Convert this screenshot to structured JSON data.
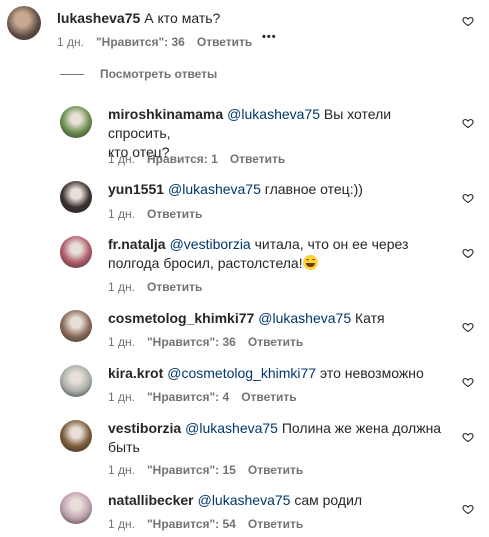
{
  "top_comment": {
    "username": "lukasheva75",
    "text": "А кто мать?",
    "time": "1 дн.",
    "likes": "\"Нравится\": 36",
    "reply": "Ответить",
    "more": "•••"
  },
  "view_replies_label": "Посмотреть ответы",
  "replies": [
    {
      "username": "miroshkinamama",
      "mention": "@lukasheva75",
      "text_line1": "Вы хотели спросить,",
      "text_line2": "кто отец?",
      "time": "1 дн.",
      "likes": "Нравится: 1",
      "reply": "Ответить",
      "avatar_color": "#6b8f4e"
    },
    {
      "username": "yun1551",
      "mention": "@lukasheva75",
      "text_line1": "главное отец:))",
      "time": "1 дн.",
      "likes": "",
      "reply": "Ответить",
      "avatar_color": "#3a3030"
    },
    {
      "username": "fr.natalja",
      "mention": "@vestiborzia",
      "text_line1": "читала, что он ее через",
      "text_line2": "полгода бросил, растолстела!",
      "emoji": "😂",
      "time": "1 дн.",
      "likes": "",
      "reply": "Ответить",
      "avatar_color": "#b05a6a"
    },
    {
      "username": "cosmetolog_khimki77",
      "mention": "@lukasheva75",
      "text_line1": "Катя",
      "time": "1 дн.",
      "likes": "\"Нравится\": 36",
      "reply": "Ответить",
      "avatar_color": "#8a6a5a"
    },
    {
      "username": "kira.krot",
      "mention": "@cosmetolog_khimki77",
      "text_line1": "это невозможно",
      "time": "1 дн.",
      "likes": "\"Нравится\": 4",
      "reply": "Ответить",
      "avatar_color": "#a8b0a8"
    },
    {
      "username": "vestiborzia",
      "mention": "@lukasheva75",
      "text_line1": "Полина же жена должна",
      "text_line2": "быть",
      "time": "1 дн.",
      "likes": "\"Нравится\": 15",
      "reply": "Ответить",
      "avatar_color": "#7a5a3a"
    },
    {
      "username": "natallibecker",
      "mention": "@lukasheva75",
      "text_line1": "сам родил",
      "time": "1 дн.",
      "likes": "\"Нравится\": 54",
      "reply": "Ответить",
      "avatar_color": "#c0a0b0"
    }
  ]
}
